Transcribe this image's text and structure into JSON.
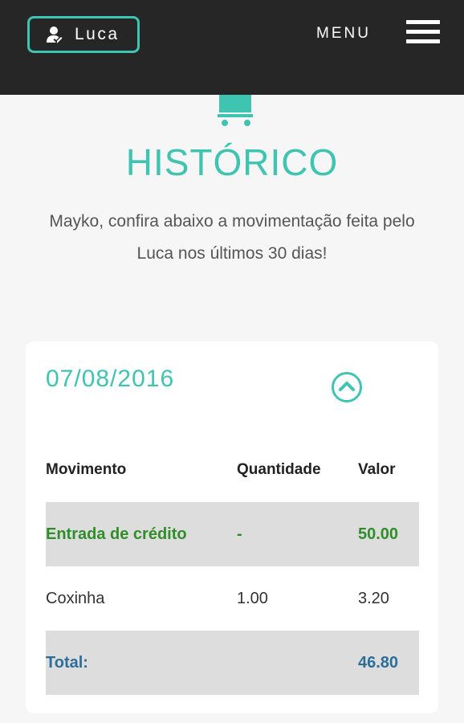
{
  "header": {
    "user_name": "Luca",
    "menu_label": "MENU"
  },
  "icons": {
    "user": "user-icon",
    "menu": "hamburger-icon",
    "cart": "shopping-cart-icon",
    "collapse": "chevron-up-circle-icon"
  },
  "colors": {
    "accent": "#3ec4b0",
    "header_bg": "#262626",
    "credit": "#2f8e2a",
    "total": "#2c6d9a"
  },
  "main": {
    "title": "HISTÓRICO",
    "intro": "Mayko, confira abaixo a movimentação feita pelo Luca nos últimos 30 dias!"
  },
  "card": {
    "date": "07/08/2016",
    "columns": [
      "Movimento",
      "Quantidade",
      "Valor"
    ],
    "rows": [
      {
        "movimento": "Entrada de crédito",
        "quantidade": "-",
        "valor": "50.00"
      },
      {
        "movimento": "Coxinha",
        "quantidade": "1.00",
        "valor": "3.20"
      }
    ],
    "total": {
      "label": "Total:",
      "valor": "46.80"
    }
  }
}
